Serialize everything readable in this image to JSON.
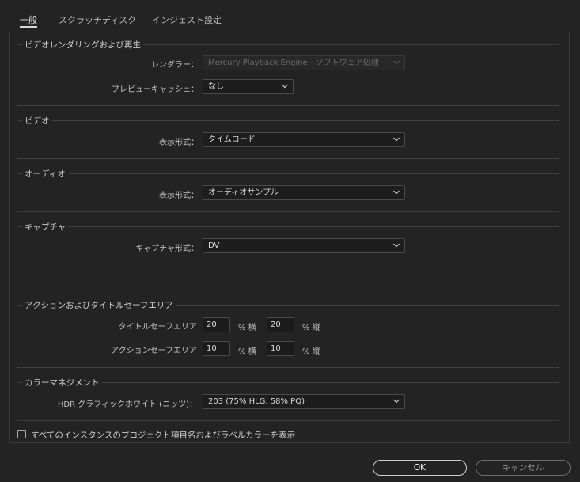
{
  "tabs": [
    {
      "label": "一般",
      "active": true
    },
    {
      "label": "スクラッチディスク",
      "active": false
    },
    {
      "label": "インジェスト設定",
      "active": false
    }
  ],
  "sections": {
    "video_rendering": {
      "title": "ビデオレンダリングおよび再生",
      "renderer_label": "レンダラー：",
      "renderer_value": "Mercury Playback Engine - ソフトウェア処理",
      "preview_cache_label": "プレビューキャッシュ：",
      "preview_cache_value": "なし"
    },
    "video": {
      "title": "ビデオ",
      "display_format_label": "表示形式：",
      "display_format_value": "タイムコード"
    },
    "audio": {
      "title": "オーディオ",
      "display_format_label": "表示形式：",
      "display_format_value": "オーディオサンプル"
    },
    "capture": {
      "title": "キャプチャ",
      "capture_format_label": "キャプチャ形式：",
      "capture_format_value": "DV"
    },
    "safe_areas": {
      "title": "アクションおよびタイトルセーフエリア",
      "title_safe_label": "タイトルセーフエリア",
      "title_safe_h": "20",
      "title_safe_v": "20",
      "action_safe_label": "アクションセーフエリア",
      "action_safe_h": "10",
      "action_safe_v": "10",
      "unit_h": "% 横",
      "unit_v": "% 縦"
    },
    "color_management": {
      "title": "カラーマネジメント",
      "hdr_label": "HDR グラフィックホワイト (ニッツ)：",
      "hdr_value": "203 (75% HLG, 58% PQ)"
    }
  },
  "checkbox": {
    "label": "すべてのインスタンスのプロジェクト項目名およびラベルカラーを表示",
    "checked": false
  },
  "buttons": {
    "ok": "OK",
    "cancel": "キャンセル"
  },
  "icons": {
    "chevron": "chevron-down-icon"
  },
  "colors": {
    "background": "#232323",
    "border": "#3f3f3f",
    "field": "#1d1d1d"
  }
}
